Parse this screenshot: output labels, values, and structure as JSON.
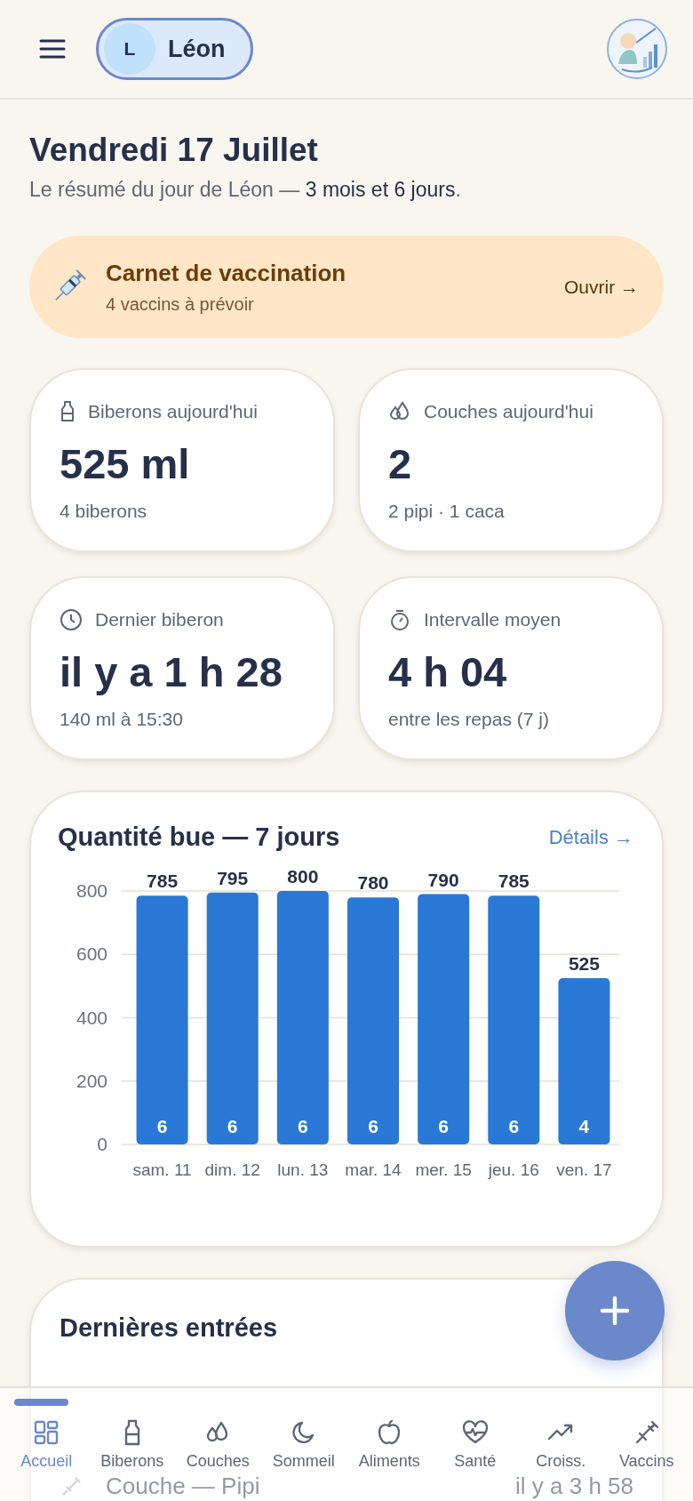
{
  "header": {
    "profile": {
      "initial": "L",
      "name": "Léon"
    }
  },
  "summary": {
    "title": "Vendredi 17 Juillet",
    "subtitle": "Le résumé du jour de Léon — **3 mois et 6 jours**."
  },
  "vaccine_banner": {
    "title": "Carnet de vaccination",
    "subtitle": "4 vaccins à prévoir",
    "action": "Ouvrir →"
  },
  "stats": [
    {
      "kind": "bottle",
      "label": "Biberons aujourd'hui",
      "value": "525 ml",
      "detail": "4 biberons"
    },
    {
      "kind": "diaper",
      "label": "Couches aujourd'hui",
      "value": "2",
      "detail": "2 pipi · 1 caca"
    },
    {
      "kind": "clock",
      "label": "Dernier biberon",
      "value": "il y a 1 h 28",
      "detail": "140 ml à 15:30"
    },
    {
      "kind": "timer",
      "label": "Intervalle moyen",
      "value": "4 h 04",
      "detail": "entre les repas (7 j)"
    }
  ],
  "intake_chart": {
    "title": "Quantité bue — 7 jours",
    "link": "Détails →",
    "bar_counts": [
      "6",
      "6",
      "6",
      "6",
      "6",
      "6",
      "4"
    ],
    "chart_data": {
      "type": "bar",
      "categories": [
        "sam. 11",
        "dim. 12",
        "lun. 13",
        "mar. 14",
        "mer. 15",
        "jeu. 16",
        "ven. 17"
      ],
      "series": [
        {
          "color": "#2a78d6",
          "values": [
            785,
            795,
            800,
            780,
            790,
            785,
            525
          ]
        }
      ],
      "ylim": [
        0,
        800
      ],
      "yticks": [
        0,
        200,
        400,
        600,
        800
      ],
      "grid": true,
      "data_labels": true
    }
  },
  "recent_entries": {
    "title": "Dernières entrées",
    "items": [
      {
        "title": "Couche — Pipi",
        "time": "il y a 3 h 58"
      }
    ]
  },
  "nav": [
    {
      "kind": "home",
      "label": "Accueil",
      "selected": true
    },
    {
      "kind": "bottle",
      "label": "Biberons",
      "selected": false
    },
    {
      "kind": "diaper",
      "label": "Couches",
      "selected": false
    },
    {
      "kind": "sleep",
      "label": "Sommeil",
      "selected": false
    },
    {
      "kind": "food",
      "label": "Aliments",
      "selected": false
    },
    {
      "kind": "health",
      "label": "Santé",
      "selected": false
    },
    {
      "kind": "growth",
      "label": "Croiss.",
      "selected": false
    },
    {
      "kind": "vaccine",
      "label": "Vaccins",
      "selected": false
    }
  ]
}
